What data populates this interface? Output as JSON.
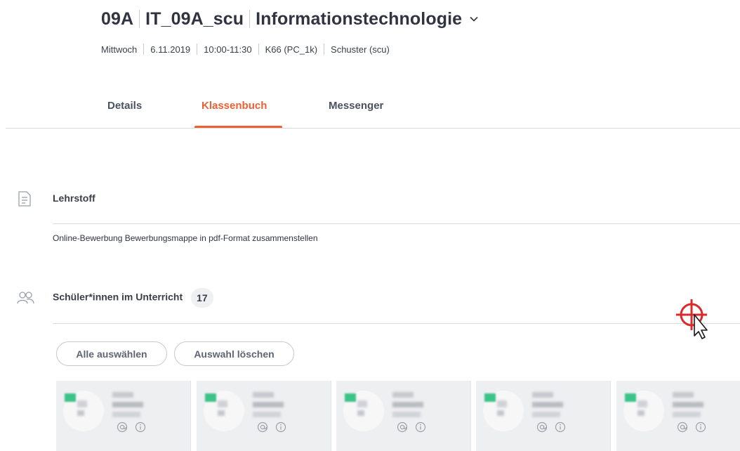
{
  "header": {
    "class_code": "09A",
    "course_code": "IT_09A_scu",
    "subject": "Informationstechnologie"
  },
  "meta": {
    "weekday": "Mittwoch",
    "date": "6.11.2019",
    "time": "10:00-11:30",
    "room": "K66 (PC_1k)",
    "teacher": "Schuster (scu)"
  },
  "tabs": [
    {
      "label": "Details",
      "active": false
    },
    {
      "label": "Klassenbuch",
      "active": true
    },
    {
      "label": "Messenger",
      "active": false
    }
  ],
  "lehrstoff": {
    "title": "Lehrstoff",
    "text": "Online-Bewerbung Bewerbungsmappe in pdf-Format zusammenstellen"
  },
  "students": {
    "title": "Schüler*innen im Unterricht",
    "count": "17",
    "select_all_label": "Alle auswählen",
    "clear_selection_label": "Auswahl löschen"
  },
  "colors": {
    "accent": "#ef5f34",
    "status_present": "#3cc488",
    "cursor_target": "#d92b2b"
  },
  "icons": {
    "lehrstoff": "document-icon",
    "students": "people-icon",
    "card_message": "at-icon",
    "card_info": "info-icon",
    "subject_dropdown": "chevron-down-icon"
  }
}
